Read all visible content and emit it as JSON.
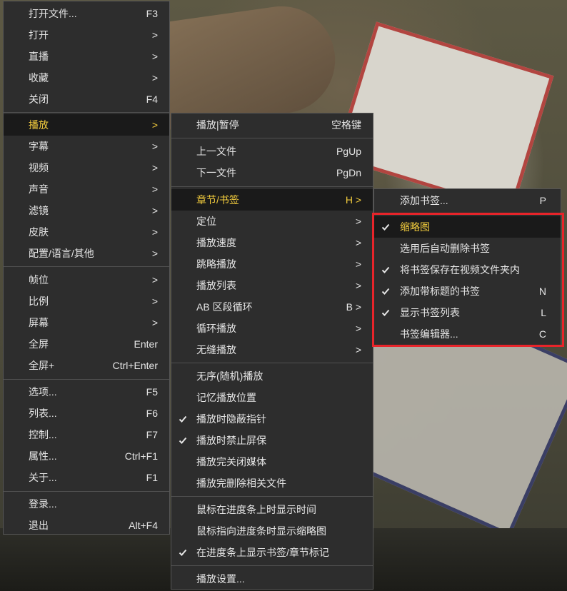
{
  "colors": {
    "menu_bg": "#2d2d2d",
    "active_bg": "#1a1a1a",
    "active_text": "#f3cc3d",
    "text": "#e6e6e6",
    "highlight_box": "#e8242a"
  },
  "main_menu": {
    "items": [
      {
        "label": "打开文件...",
        "shortcut": "F3"
      },
      {
        "label": "打开",
        "shortcut": ">"
      },
      {
        "label": "直播",
        "shortcut": ">"
      },
      {
        "label": "收藏",
        "shortcut": ">"
      },
      {
        "label": "关闭",
        "shortcut": "F4"
      },
      {
        "label": "播放",
        "shortcut": ">"
      },
      {
        "label": "字幕",
        "shortcut": ">"
      },
      {
        "label": "视频",
        "shortcut": ">"
      },
      {
        "label": "声音",
        "shortcut": ">"
      },
      {
        "label": "滤镜",
        "shortcut": ">"
      },
      {
        "label": "皮肤",
        "shortcut": ">"
      },
      {
        "label": "配置/语言/其他",
        "shortcut": ">"
      },
      {
        "label": "帧位",
        "shortcut": ">"
      },
      {
        "label": "比例",
        "shortcut": ">"
      },
      {
        "label": "屏幕",
        "shortcut": ">"
      },
      {
        "label": "全屏",
        "shortcut": "Enter"
      },
      {
        "label": "全屏+",
        "shortcut": "Ctrl+Enter"
      },
      {
        "label": "选项...",
        "shortcut": "F5"
      },
      {
        "label": "列表...",
        "shortcut": "F6"
      },
      {
        "label": "控制...",
        "shortcut": "F7"
      },
      {
        "label": "属性...",
        "shortcut": "Ctrl+F1"
      },
      {
        "label": "关于...",
        "shortcut": "F1"
      },
      {
        "label": "登录...",
        "shortcut": ""
      },
      {
        "label": "退出",
        "shortcut": "Alt+F4"
      }
    ]
  },
  "play_menu": {
    "items": [
      {
        "label": "播放|暂停",
        "shortcut": "空格键"
      },
      {
        "label": "上一文件",
        "shortcut": "PgUp"
      },
      {
        "label": "下一文件",
        "shortcut": "PgDn"
      },
      {
        "label": "章节/书签",
        "shortcut": "H >"
      },
      {
        "label": "定位",
        "shortcut": ">"
      },
      {
        "label": "播放速度",
        "shortcut": ">"
      },
      {
        "label": "跳略播放",
        "shortcut": ">"
      },
      {
        "label": "播放列表",
        "shortcut": ">"
      },
      {
        "label": "AB 区段循环",
        "shortcut": "B >"
      },
      {
        "label": "循环播放",
        "shortcut": ">"
      },
      {
        "label": "无缝播放",
        "shortcut": ">"
      },
      {
        "label": "无序(随机)播放",
        "shortcut": ""
      },
      {
        "label": "记忆播放位置",
        "shortcut": ""
      },
      {
        "label": "播放时隐蔽指针",
        "shortcut": "",
        "checked": true
      },
      {
        "label": "播放时禁止屏保",
        "shortcut": "",
        "checked": true
      },
      {
        "label": "播放完关闭媒体",
        "shortcut": ""
      },
      {
        "label": "播放完删除相关文件",
        "shortcut": ""
      },
      {
        "label": "鼠标在进度条上时显示时间",
        "shortcut": ""
      },
      {
        "label": "鼠标指向进度条时显示缩略图",
        "shortcut": ""
      },
      {
        "label": "在进度条上显示书签/章节标记",
        "shortcut": "",
        "checked": true
      },
      {
        "label": "播放设置...",
        "shortcut": ""
      }
    ]
  },
  "bookmark_menu": {
    "items": [
      {
        "label": "添加书签...",
        "shortcut": "P"
      },
      {
        "label": "缩略图",
        "shortcut": "",
        "checked": true
      },
      {
        "label": "选用后自动删除书签",
        "shortcut": ""
      },
      {
        "label": "将书签保存在视频文件夹内",
        "shortcut": "",
        "checked": true
      },
      {
        "label": "添加带标题的书签",
        "shortcut": "N",
        "checked": true
      },
      {
        "label": "显示书签列表",
        "shortcut": "L",
        "checked": true
      },
      {
        "label": "书签编辑器...",
        "shortcut": "C"
      }
    ]
  }
}
